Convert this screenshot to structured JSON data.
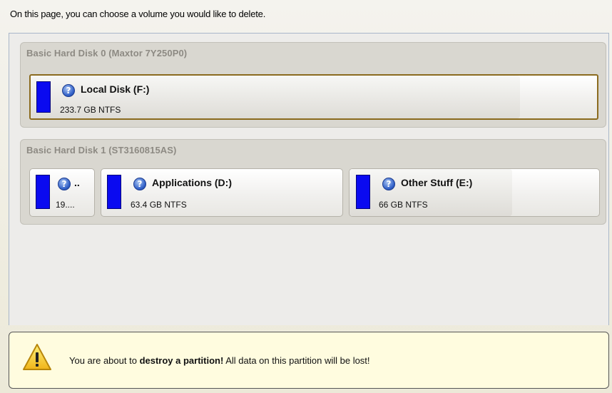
{
  "instruction": "On this page, you can choose a volume you would like to delete.",
  "disks": [
    {
      "title": "Basic Hard Disk 0 (Maxtor 7Y250P0)",
      "partitions": [
        {
          "name": "Local Disk (F:)",
          "size": "233.7 GB NTFS",
          "icon": "help-icon",
          "color": "#0a0af0",
          "selected": true
        }
      ]
    },
    {
      "title": "Basic Hard Disk 1 (ST3160815AS)",
      "partitions": [
        {
          "name": "..",
          "size": "19....",
          "icon": "help-icon",
          "color": "#0a0af0",
          "selected": false
        },
        {
          "name": "Applications (D:)",
          "size": "63.4 GB NTFS",
          "icon": "help-icon",
          "color": "#0a0af0",
          "selected": false
        },
        {
          "name": "Other Stuff (E:)",
          "size": "66 GB NTFS",
          "icon": "help-icon",
          "color": "#0a0af0",
          "selected": false
        }
      ]
    }
  ],
  "warning": {
    "icon": "warning-icon",
    "prefix": "You are about to ",
    "emphasis": "destroy a partition!",
    "suffix": " All data on this partition will be lost!"
  },
  "colors": {
    "volume_bar": "#0a0af0",
    "selection_border": "#8b6b1f",
    "warning_bg": "#fffcdf"
  }
}
